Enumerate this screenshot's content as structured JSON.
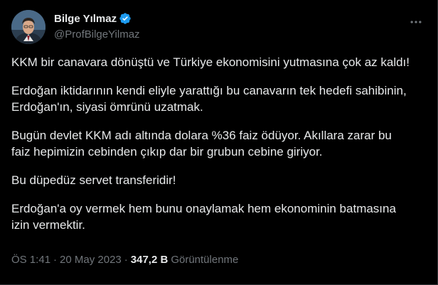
{
  "author": {
    "name": "Bilge Yılmaz",
    "handle": "@ProfBilgeYilmaz",
    "verified": true,
    "avatar_icon": "profile-photo"
  },
  "tweet": {
    "paragraphs": [
      "KKM bir canavara dönüştü ve Türkiye ekonomisini yutmasına çok az kaldı!",
      "Erdoğan iktidarının kendi eliyle yarattığı bu canavarın tek hedefi sahibinin, Erdoğan'ın, siyasi ömrünü uzatmak.",
      "Bugün devlet KKM adı altında dolara %36 faiz ödüyor. Akıllara zarar bu faiz hepimizin cebinden çıkıp dar bir grubun cebine giriyor.",
      "Bu düpedüz servet transferidir!",
      "Erdoğan'a oy vermek hem bunu onaylamak hem ekonominin batmasına izin vermektir."
    ],
    "time": "ÖS 1:41",
    "date": "20 May 2023",
    "separator": "·",
    "views_count": "347,2 B",
    "views_label": "Görüntülenme"
  },
  "colors": {
    "background": "#000000",
    "text_primary": "#e7e9ea",
    "text_secondary": "#71767b",
    "verified_badge": "#1d9bf0",
    "border": "#2f3336"
  }
}
